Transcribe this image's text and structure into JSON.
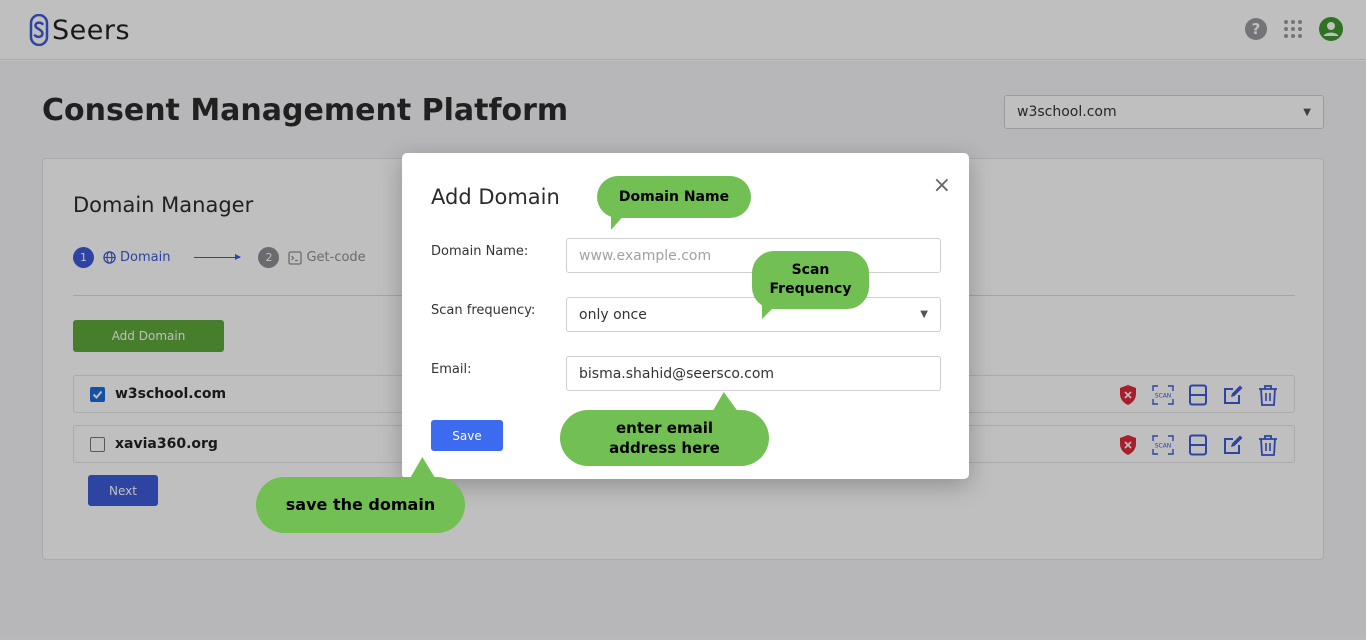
{
  "app": {
    "logo_text": "Seers"
  },
  "header": {
    "icons": [
      "help-icon",
      "apps-grid-icon",
      "account-icon"
    ]
  },
  "page": {
    "title": "Consent Management Platform",
    "domain_selector": "w3school.com"
  },
  "card": {
    "title": "Domain Manager",
    "steps": [
      {
        "number": "1",
        "label": "Domain",
        "icon": "globe-icon"
      },
      {
        "number": "2",
        "label": "Get-code",
        "icon": "terminal-icon"
      }
    ],
    "add_domain_label": "Add Domain",
    "domains": [
      {
        "name": "w3school.com",
        "checked": true
      },
      {
        "name": "xavia360.org",
        "checked": false
      }
    ],
    "row_action_icons": [
      "shield-icon",
      "scan-icon",
      "save-icon",
      "edit-icon",
      "trash-icon"
    ],
    "next_label": "Next"
  },
  "modal": {
    "title": "Add Domain",
    "close_glyph": "×",
    "fields": {
      "domain_name": {
        "label": "Domain Name:",
        "placeholder": "www.example.com",
        "value": ""
      },
      "scan_frequency": {
        "label": "Scan frequency:",
        "value": "only once"
      },
      "email": {
        "label": "Email:",
        "value": "bisma.shahid@seersco.com"
      }
    },
    "save_label": "Save"
  },
  "callouts": {
    "domain_name": "Domain Name",
    "scan_frequency": "Scan Frequency",
    "email": "enter email address here",
    "save": "save the domain"
  },
  "colors": {
    "primary": "#3c5bd8",
    "green": "#5ea83a",
    "callout": "#72bf54",
    "danger": "#e0293a"
  }
}
